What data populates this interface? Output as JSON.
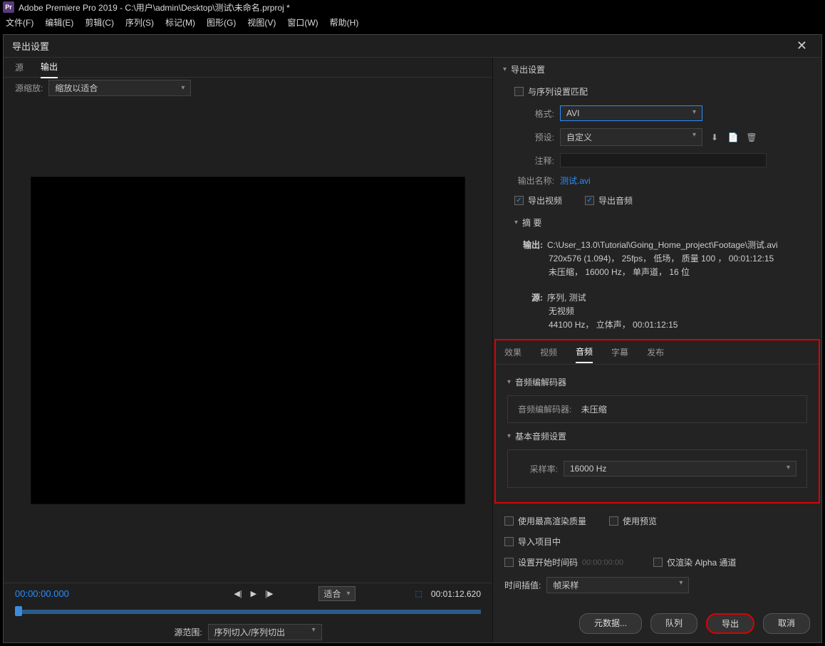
{
  "app": {
    "icon_text": "Pr",
    "title": "Adobe Premiere Pro 2019 - C:\\用户\\admin\\Desktop\\测试\\未命名.prproj *"
  },
  "menu": [
    "文件(F)",
    "编辑(E)",
    "剪辑(C)",
    "序列(S)",
    "标记(M)",
    "图形(G)",
    "视图(V)",
    "窗口(W)",
    "帮助(H)"
  ],
  "dialog": {
    "title": "导出设置",
    "close": "✕"
  },
  "preview": {
    "tab_source": "源",
    "tab_output": "输出",
    "scale_label": "源缩放:",
    "scale_value": "缩放以适合",
    "tc_start": "00:00:00.000",
    "fit_label": "适合",
    "tc_end": "00:01:12.620",
    "range_label": "源范围:",
    "range_value": "序列切入/序列切出"
  },
  "export": {
    "section_title": "导出设置",
    "match_seq": "与序列设置匹配",
    "format_label": "格式:",
    "format_value": "AVI",
    "preset_label": "预设:",
    "preset_value": "自定义",
    "comment_label": "注释:",
    "output_name_label": "输出名称:",
    "output_name_value": "测试.avi",
    "export_video": "导出视频",
    "export_audio": "导出音频",
    "summary_title": "摘 要",
    "summary_output_label": "输出:",
    "summary_output_line1": "C:\\User_13.0\\Tutorial\\Going_Home_project\\Footage\\测试.avi",
    "summary_output_line2": "720x576 (1.094)， 25fps， 低场， 质量 100 ， 00:01:12:15",
    "summary_output_line3": "未压缩， 16000 Hz， 单声道， 16 位",
    "summary_source_label": "源:",
    "summary_source_line1": "序列, 测试",
    "summary_source_line2": "无视频",
    "summary_source_line3": "44100 Hz， 立体声， 00:01:12:15"
  },
  "tabs": {
    "effects": "效果",
    "video": "视频",
    "audio": "音频",
    "captions": "字幕",
    "publish": "发布"
  },
  "audio": {
    "codec_title": "音频编解码器",
    "codec_label": "音频编解码器:",
    "codec_value": "未压缩",
    "basic_title": "基本音频设置",
    "sample_label": "采样率:",
    "sample_value": "16000 Hz"
  },
  "options": {
    "max_quality": "使用最高渲染质量",
    "use_preview": "使用预览",
    "import_project": "导入项目中",
    "set_start_tc": "设置开始时间码",
    "start_tc_value": "00:00:00:00",
    "render_alpha": "仅渲染 Alpha 通道",
    "time_interp_label": "时间插值:",
    "time_interp_value": "帧采样"
  },
  "footer": {
    "metadata": "元数据...",
    "queue": "队列",
    "export": "导出",
    "cancel": "取消"
  }
}
